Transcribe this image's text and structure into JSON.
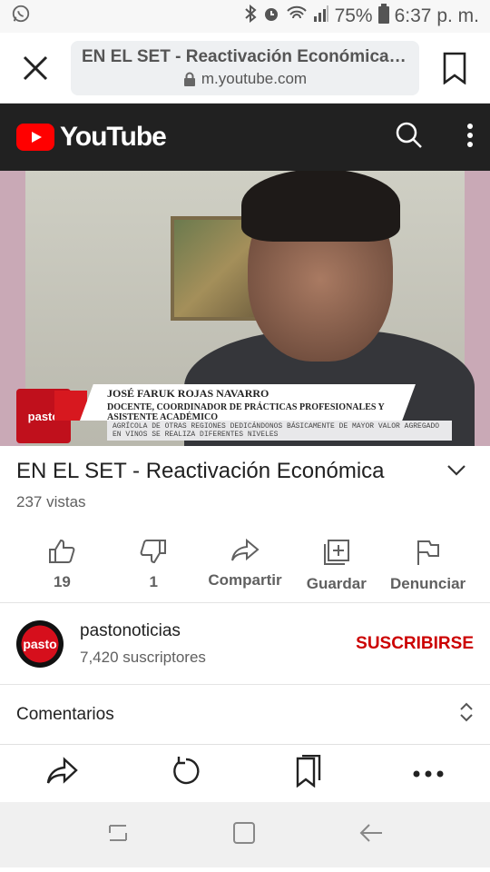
{
  "status_bar": {
    "battery": "75%",
    "time": "6:37 p. m."
  },
  "browser": {
    "page_title": "EN EL SET - Reactivación Económica - ...",
    "host": "m.youtube.com"
  },
  "youtube": {
    "logo_text": "YouTube"
  },
  "video_overlay": {
    "badge": "pasto",
    "name": "JOSÉ FARUK ROJAS NAVARRO",
    "role": "DOCENTE, COORDINADOR DE PRÁCTICAS PROFESIONALES Y ASISTENTE ACADÉMICO",
    "ticker": "AGRÍCOLA DE OTRAS REGIONES DEDICÁNDONOS BÁSICAMENTE DE MAYOR VALOR AGREGADO EN VINOS SE REALIZA DIFERENTES NIVELES"
  },
  "video_info": {
    "title": "EN EL SET - Reactivación Económica",
    "views": "237 vistas",
    "actions": [
      {
        "icon": "thumbs-up-icon",
        "label": "19"
      },
      {
        "icon": "thumbs-down-icon",
        "label": "1"
      },
      {
        "icon": "share-icon",
        "label": "Compartir"
      },
      {
        "icon": "add-to-playlist-icon",
        "label": "Guardar"
      },
      {
        "icon": "flag-icon",
        "label": "Denunciar"
      }
    ]
  },
  "channel": {
    "avatar_text": "pasto",
    "name": "pastonoticias",
    "subscribers": "7,420 suscriptores",
    "subscribe_label": "SUSCRIBIRSE"
  },
  "comments": {
    "label": "Comentarios"
  },
  "colors": {
    "yt_red": "#ff0000",
    "subscribe_red": "#cc0000",
    "header_bg": "#212121"
  }
}
